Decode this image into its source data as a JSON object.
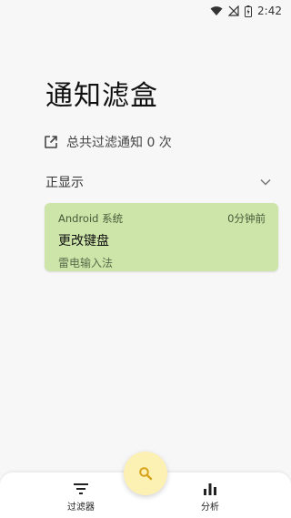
{
  "status_bar": {
    "time": "2:42",
    "icons": [
      "wifi-icon",
      "no-signal-icon",
      "battery-charging-icon"
    ]
  },
  "header": {
    "title": "通知滤盒"
  },
  "summary": {
    "icon": "open-external-icon",
    "text": "总共过滤通知 0 次"
  },
  "section": {
    "label": "正显示",
    "icon": "chevron-down-icon"
  },
  "notifications": [
    {
      "app": "Android 系统",
      "time": "0分钟前",
      "title": "更改键盘",
      "subtitle": "雷电输入法",
      "color": "#cde5a8"
    }
  ],
  "bottom_nav": {
    "items": [
      {
        "label": "过滤器",
        "icon": "filter-icon"
      },
      {
        "label": "分析",
        "icon": "bar-chart-icon"
      }
    ],
    "fab_icon": "search-icon",
    "fab_color": "#fdf0b3"
  }
}
